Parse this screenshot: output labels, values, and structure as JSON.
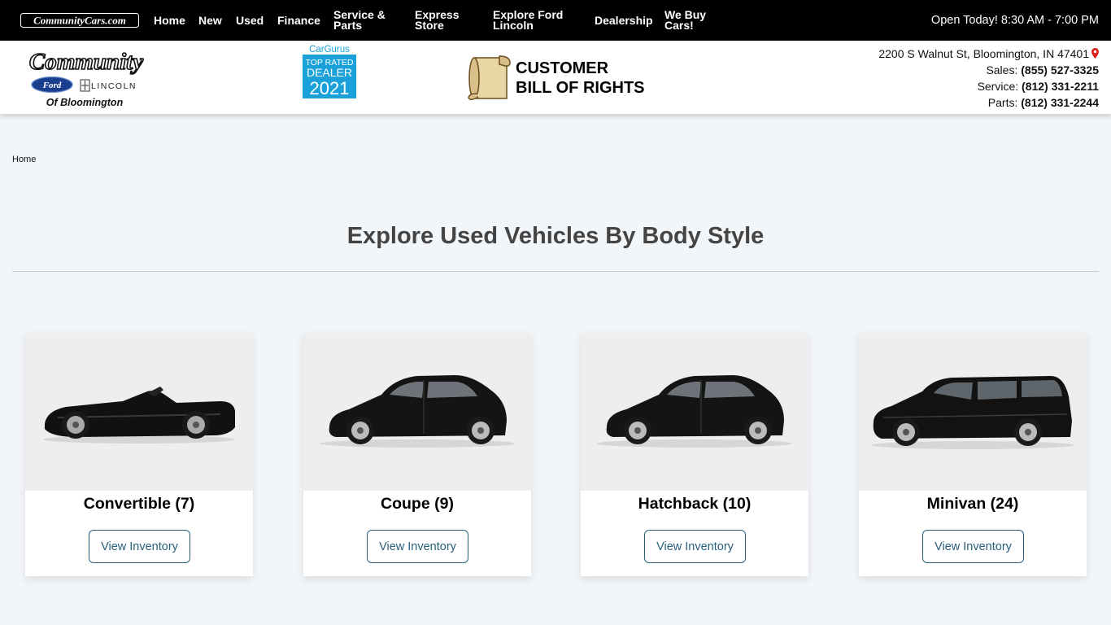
{
  "topnav": {
    "site_logo_text": "CommunityCars.com",
    "items": [
      {
        "label": "Home"
      },
      {
        "label": "New"
      },
      {
        "label": "Used"
      },
      {
        "label": "Finance"
      },
      {
        "label_line1": "Service &",
        "label_line2": "Parts"
      },
      {
        "label_line1": "Express",
        "label_line2": "Store"
      },
      {
        "label_line1": "Explore Ford",
        "label_line2": "Lincoln"
      },
      {
        "label": "Dealership"
      },
      {
        "label_line1": "We Buy",
        "label_line2": "Cars!"
      }
    ],
    "hours": "Open Today! 8:30 AM - 7:00 PM"
  },
  "header": {
    "logo": {
      "line1": "Community",
      "ford": "Ford",
      "lincoln": "LINCOLN",
      "line3": "Of Bloomington"
    },
    "badge": {
      "brand": "CarGurus",
      "line1": "TOP RATED",
      "line2": "DEALER",
      "year": "2021"
    },
    "bill_of_rights": {
      "line1": "CUSTOMER",
      "line2": "BILL OF RIGHTS"
    },
    "contact": {
      "address": "2200 S Walnut St, Bloomington, IN 47401",
      "sales_label": "Sales:",
      "sales_phone": "(855) 527-3325",
      "service_label": "Service:",
      "service_phone": "(812) 331-2211",
      "parts_label": "Parts:",
      "parts_phone": "(812) 331-2244"
    }
  },
  "breadcrumb": "Home",
  "page_title": "Explore Used Vehicles By Body Style",
  "cards": [
    {
      "title": "Convertible (7)",
      "button": "View Inventory",
      "image": "black-convertible-car"
    },
    {
      "title": "Coupe (9)",
      "button": "View Inventory",
      "image": "black-hatchback-car"
    },
    {
      "title": "Hatchback (10)",
      "button": "View Inventory",
      "image": "black-hatchback-car"
    },
    {
      "title": "Minivan (24)",
      "button": "View Inventory",
      "image": "black-minivan"
    }
  ],
  "colors": {
    "nav_bg": "#000000",
    "page_bg": "#f3f6f9",
    "button_accent": "#2a5f7c",
    "cargurus_blue": "#1aa1d9",
    "pin_red": "#d9221c"
  }
}
